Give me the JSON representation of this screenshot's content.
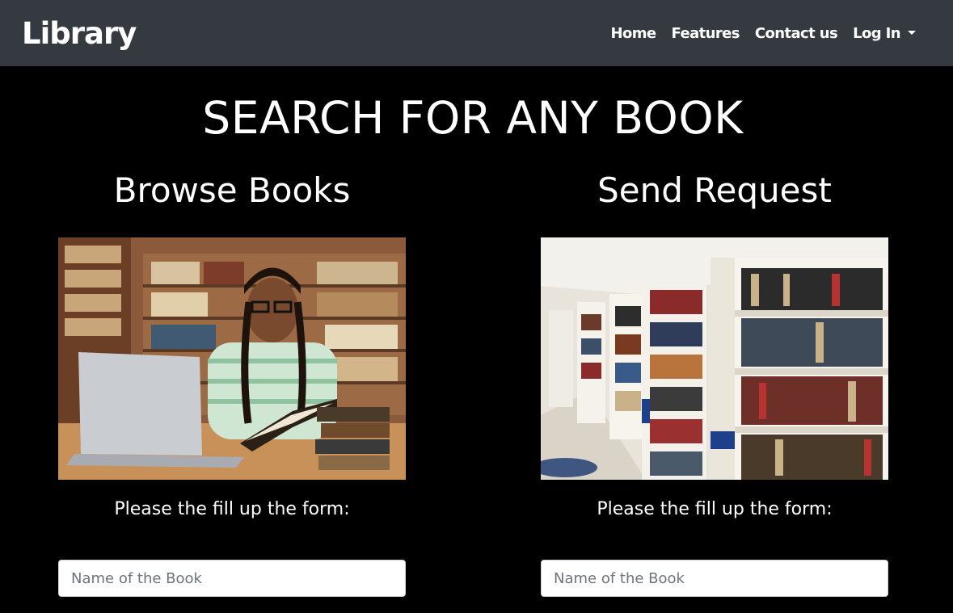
{
  "navbar": {
    "brand": "Library",
    "links": [
      {
        "label": "Home"
      },
      {
        "label": "Features"
      },
      {
        "label": "Contact us"
      },
      {
        "label": "Log In"
      }
    ]
  },
  "hero": {
    "title": "SEARCH FOR ANY BOOK"
  },
  "columns": [
    {
      "title": "Browse Books",
      "image": "photo of a woman reading a book next to a laptop in a library",
      "form_label": "Please the fill up the form:",
      "input_placeholder": "Name of the Book"
    },
    {
      "title": "Send Request",
      "image": "photo of library bookshelf aisles",
      "form_label": "Please the fill up the form:",
      "input_placeholder": "Name of the Book"
    }
  ],
  "colors": {
    "navbar_bg": "#343a40",
    "page_bg": "#000000",
    "text": "#ffffff"
  }
}
